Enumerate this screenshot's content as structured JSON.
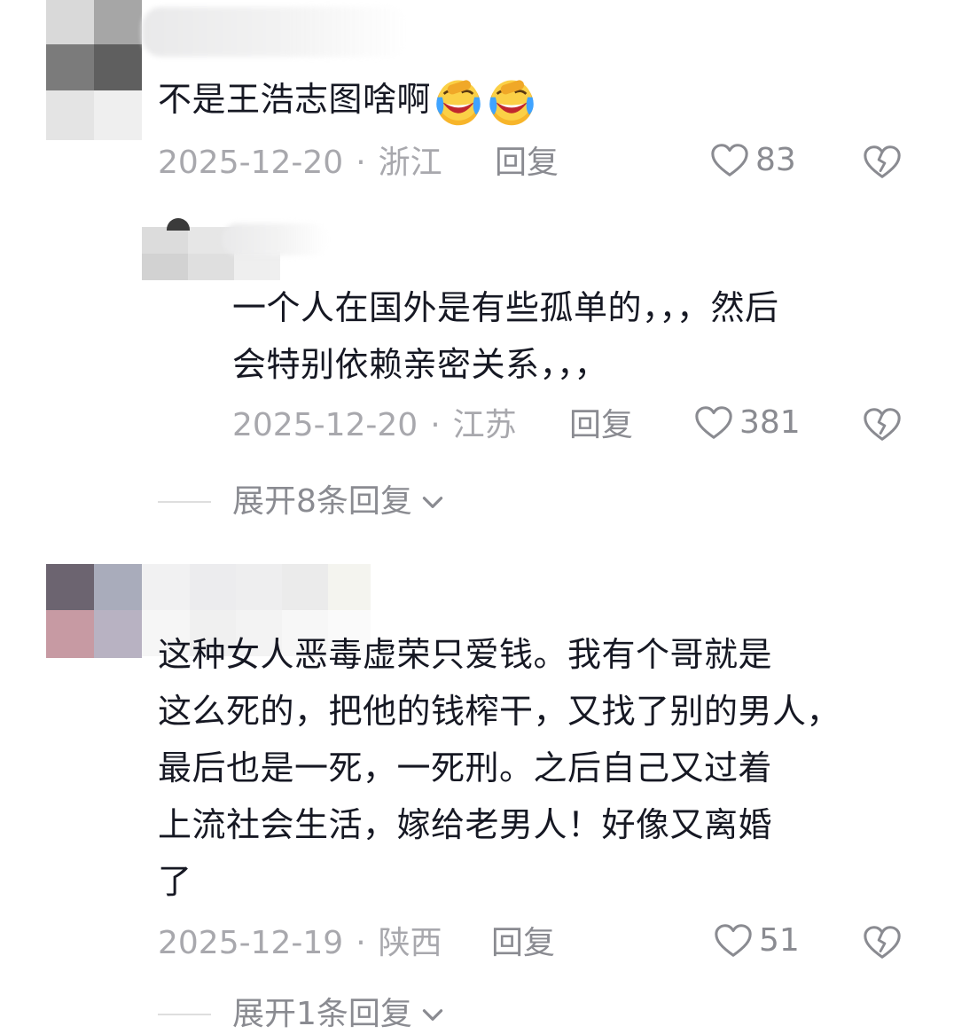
{
  "comments": [
    {
      "text": "不是王浩志图啥啊",
      "emojis": [
        "crying-laughing-emoji",
        "crying-laughing-emoji"
      ],
      "date": "2025-12-20",
      "location": "浙江",
      "reply_label": "回复",
      "likes": "83"
    },
    {
      "text": "一个人在国外是有些孤单的，，，然后\n会特别依赖亲密关系，，，",
      "date": "2025-12-20",
      "location": "江苏",
      "reply_label": "回复",
      "likes": "381",
      "is_reply": true
    },
    {
      "text": "这种女人恶毒虚荣只爱钱。我有个哥就是\n这么死的，把他的钱榨干，又找了别的男人，\n最后也是一死，一死刑。之后自己又过着\n上流社会生活，嫁给老男人！好像又离婚\n了",
      "date": "2025-12-19",
      "location": "陕西",
      "reply_label": "回复",
      "likes": "51"
    }
  ],
  "expand_replies_1": "展开8条回复",
  "expand_replies_2": "展开1条回复",
  "dot": "·",
  "colors": {
    "text": "#161823",
    "meta": "#a8a8ad",
    "action": "#8a8b91"
  },
  "icons": {
    "like": "heart-outline-icon",
    "dislike": "broken-heart-icon",
    "expand": "chevron-down-icon"
  }
}
